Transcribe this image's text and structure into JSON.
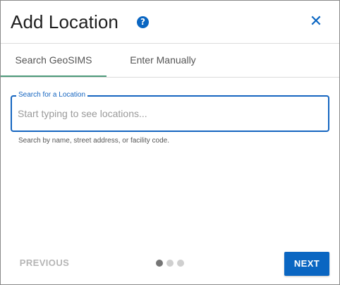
{
  "dialog": {
    "title": "Add Location",
    "help_icon": "question-circle",
    "help_glyph": "?",
    "close_icon": "close-x",
    "close_glyph": "✕"
  },
  "tabs": [
    {
      "label": "Search GeoSIMS",
      "selected": true
    },
    {
      "label": "Enter Manually",
      "selected": false
    }
  ],
  "search": {
    "label": "Search for a Location",
    "value": "",
    "placeholder": "Start typing to see locations...",
    "helper_text": "Search by name, street address, or facility code."
  },
  "footer": {
    "previous_label": "PREVIOUS",
    "next_label": "NEXT",
    "steps_total": 3,
    "current_step": 1
  },
  "colors": {
    "accent": "#0a66c2",
    "tab_indicator": "#4d9a7a",
    "disabled_text": "#b5b5b5"
  }
}
